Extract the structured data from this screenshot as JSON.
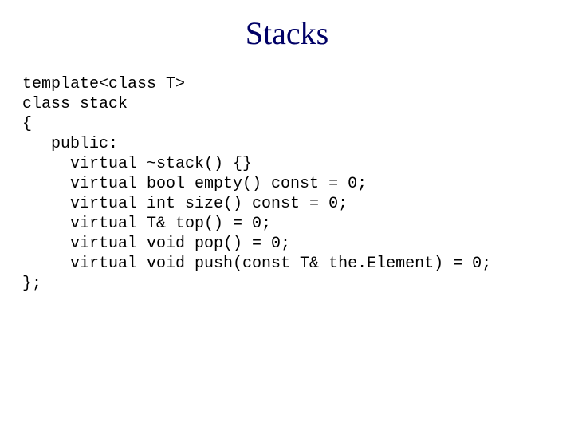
{
  "title": "Stacks",
  "code": {
    "l0": "template<class T>",
    "l1": "class stack",
    "l2": "{",
    "l3": "   public:",
    "l4": "     virtual ~stack() {}",
    "l5": "     virtual bool empty() const = 0;",
    "l6": "     virtual int size() const = 0;",
    "l7": "     virtual T& top() = 0;",
    "l8": "     virtual void pop() = 0;",
    "l9": "     virtual void push(const T& the.Element) = 0;",
    "l10": "};"
  }
}
